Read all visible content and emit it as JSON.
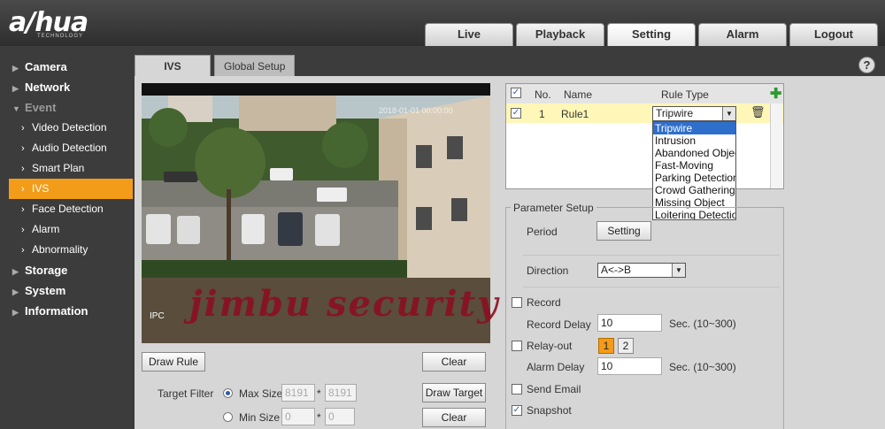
{
  "brand": {
    "logo": "a/hua",
    "sub": "TECHNOLOGY"
  },
  "topnav": [
    "Live",
    "Playback",
    "Setting",
    "Alarm",
    "Logout"
  ],
  "sidebar": {
    "camera": "Camera",
    "network": "Network",
    "event": "Event",
    "event_items": [
      "Video Detection",
      "Audio Detection",
      "Smart Plan",
      "IVS",
      "Face Detection",
      "Alarm",
      "Abnormality"
    ],
    "storage": "Storage",
    "system": "System",
    "information": "Information"
  },
  "tabs": {
    "ivs": "IVS",
    "global": "Global Setup"
  },
  "video": {
    "overlay": "IPC",
    "timestamp": "2018-01-01 00:00:00",
    "watermark": "jimbu security"
  },
  "buttons": {
    "draw_rule": "Draw Rule",
    "clear": "Clear",
    "draw_target": "Draw Target",
    "clear2": "Clear",
    "setting": "Setting"
  },
  "target_filter": {
    "label": "Target Filter",
    "max_label": "Max Size",
    "min_label": "Min Size",
    "max_w": "8191",
    "max_h": "8191",
    "min_w": "0",
    "min_h": "0",
    "times": "*"
  },
  "rules": {
    "headers": {
      "no": "No.",
      "name": "Name",
      "type": "Rule Type"
    },
    "row": {
      "no": "1",
      "name": "Rule1",
      "type": "Tripwire"
    },
    "options": [
      "Tripwire",
      "Intrusion",
      "Abandoned Object",
      "Fast-Moving",
      "Parking Detection",
      "Crowd Gathering Estimation",
      "Missing Object",
      "Loitering Detection"
    ]
  },
  "params": {
    "legend": "Parameter Setup",
    "period": "Period",
    "direction": "Direction",
    "direction_value": "A<->B",
    "record": "Record",
    "record_delay": "Record Delay",
    "record_delay_value": "10",
    "record_delay_unit": "Sec. (10~300)",
    "relay_out": "Relay-out",
    "relay_1": "1",
    "relay_2": "2",
    "alarm_delay": "Alarm Delay",
    "alarm_delay_value": "10",
    "alarm_delay_unit": "Sec. (10~300)",
    "send_email": "Send Email",
    "snapshot": "Snapshot"
  },
  "colors": {
    "accent": "#f39c19",
    "highlight": "#fff7b8",
    "selected": "#2f6fcc"
  }
}
